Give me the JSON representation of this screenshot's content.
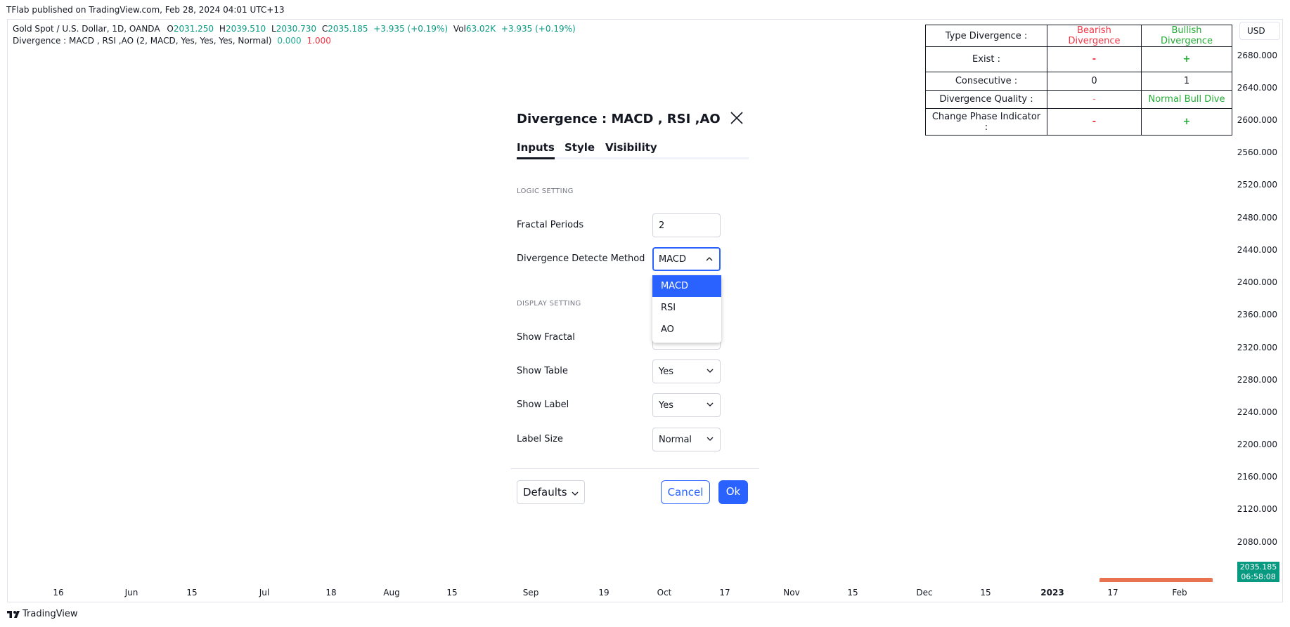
{
  "caption": "TFlab published on TradingView.com, Feb 28, 2024 04:01 UTC+13",
  "legend": {
    "symbol": "Gold Spot / U.S. Dollar, 1D, OANDA",
    "o_label": "O",
    "o_value": "2031.250",
    "h_label": "H",
    "h_value": "2039.510",
    "l_label": "L",
    "l_value": "2030.730",
    "c_label": "C",
    "c_value": "2035.185",
    "change": "+3.935 (+0.19%)",
    "vol_label": "Vol",
    "vol_value": "63.02K",
    "vol_change": "+3.935 (+0.19%)",
    "indicator": "Divergence : MACD , RSI ,AO (2, MACD, Yes, Yes, Yes, Normal)",
    "ind_value1": "0.000",
    "ind_value2": "1.000"
  },
  "currency": "USD",
  "price_ticks": [
    "2680.000",
    "2640.000",
    "2600.000",
    "2560.000",
    "2520.000",
    "2480.000",
    "2440.000",
    "2400.000",
    "2360.000",
    "2320.000",
    "2280.000",
    "2240.000",
    "2200.000",
    "2160.000",
    "2120.000",
    "2080.000"
  ],
  "price_label": {
    "price": "2035.185",
    "countdown": "06:58:08"
  },
  "time_ticks": [
    "16",
    "Jun",
    "15",
    "Jul",
    "18",
    "Aug",
    "15",
    "Sep",
    "19",
    "Oct",
    "17",
    "Nov",
    "15",
    "Dec",
    "15",
    "2023",
    "17",
    "Feb"
  ],
  "brand": "TradingView",
  "table": {
    "header": [
      "Type Divergence :",
      "Bearish Divergence",
      "Bullish Divergence"
    ],
    "exist": [
      "Exist :",
      "-",
      "+"
    ],
    "consecutive": [
      "Consecutive :",
      "0",
      "1"
    ],
    "quality": [
      "Divergence Quality :",
      "-",
      "Normal Bull Dive"
    ],
    "phase": [
      "Change Phase Indicator :",
      "-",
      "+"
    ]
  },
  "dialog": {
    "title": "Divergence : MACD , RSI ,AO",
    "tabs": [
      "Inputs",
      "Style",
      "Visibility"
    ],
    "logic_section": "LOGIC SETTING",
    "fractal_periods_label": "Fractal Periods",
    "fractal_periods_value": "2",
    "method_label": "Divergence Detecte Method",
    "method_value": "MACD",
    "method_options": [
      "MACD",
      "RSI",
      "AO"
    ],
    "display_section": "DISPLAY SETTING",
    "show_fractal_label": "Show Fractal",
    "show_table_label": "Show Table",
    "show_table_value": "Yes",
    "show_label_label": "Show Label",
    "show_label_value": "Yes",
    "label_size_label": "Label Size",
    "label_size_value": "Normal",
    "defaults_label": "Defaults",
    "cancel_label": "Cancel",
    "ok_label": "Ok"
  }
}
